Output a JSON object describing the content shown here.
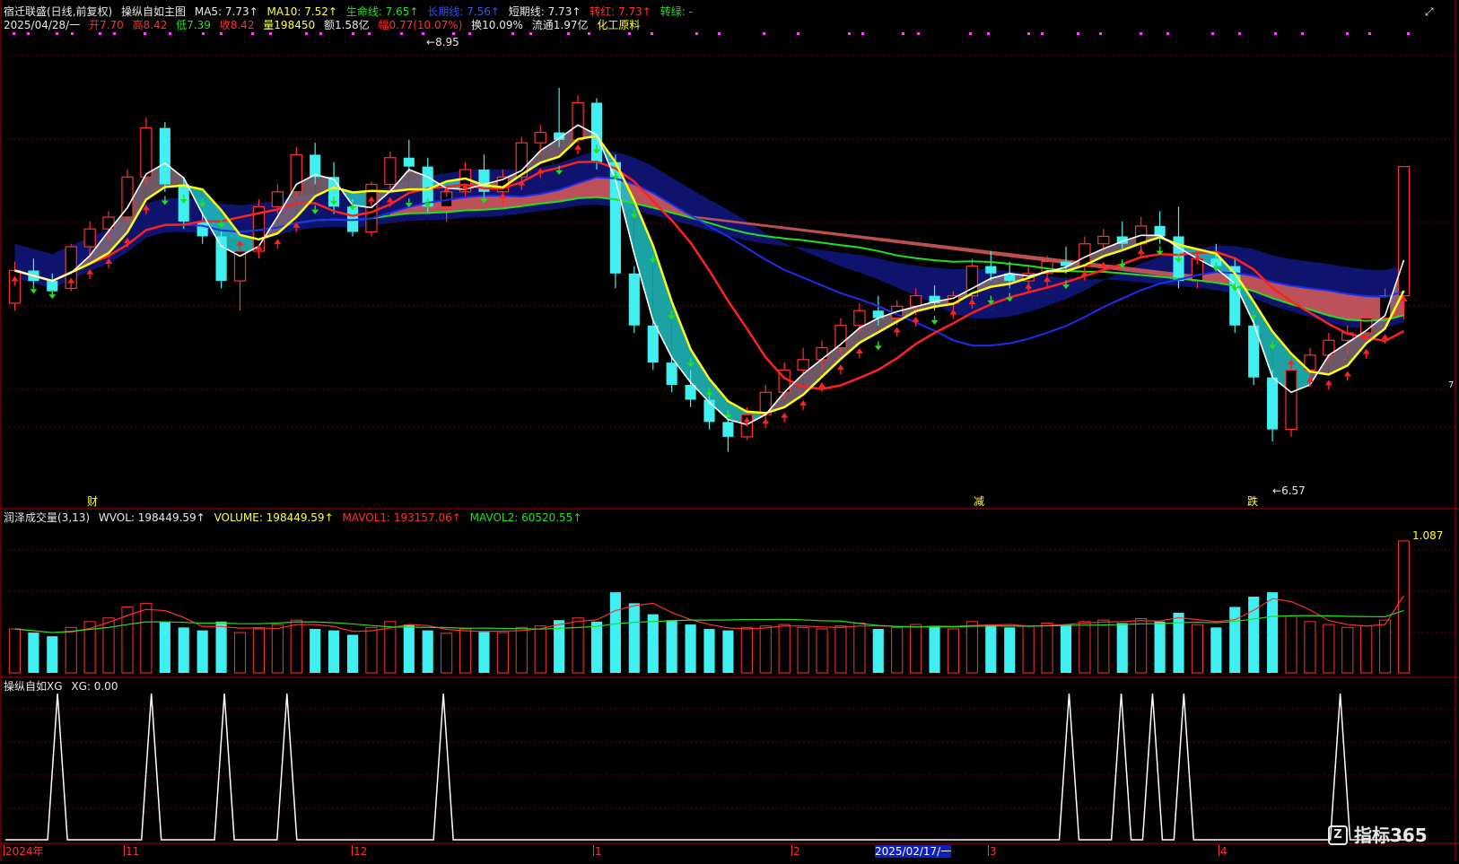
{
  "header": {
    "stock_name": "宿迁联盛(日线,前复权)",
    "indicator_name": "操纵自如主图",
    "ma5": "MA5: 7.73↑",
    "ma10": "MA10: 7.52↑",
    "life_line": "生命线: 7.65↑",
    "long_line": "长期线: 7.56↑",
    "short_line": "短期线: 7.73↑",
    "turn_red": "转红: 7.73↑",
    "turn_green": "转绿: -"
  },
  "info_bar": {
    "date": "2025/04/28/一",
    "open": "开7.70",
    "high": "高8.42",
    "low": "低7.39",
    "close": "收8.42",
    "volume": "量198450",
    "amount": "额1.58亿",
    "change": "幅0.77(10.07%)",
    "turnover": "换10.09%",
    "float": "流通1.97亿",
    "sector": "化工原料"
  },
  "annotations": {
    "high_marker": "8.95",
    "low_marker": "6.57",
    "event_cai": "财",
    "event_jian": "减",
    "event_die": "跌",
    "right_price": "7"
  },
  "volume_panel": {
    "title": "润泽成交量(3,13)",
    "wvol": "WVOL: 198449.59↑",
    "volume": "VOLUME: 198449.59↑",
    "mavol1": "MAVOL1: 193157.06↑",
    "mavol2": "MAVOL2: 60520.55↑",
    "scale_label": "1.087"
  },
  "xg_panel": {
    "title": "操纵自如XG",
    "xg": "XG: 0.00"
  },
  "x_axis": {
    "labels": [
      "2024年",
      "11",
      "12",
      "1",
      "2",
      "2025/02/17/一",
      "3",
      "4"
    ]
  },
  "watermark": "指标365",
  "colors": {
    "up": "#ff3030",
    "down": "#40f0f0",
    "ma_white": "#ffffff",
    "ma_yellow": "#ffff00",
    "life_green": "#20e020",
    "long_blue": "#1c2cf0",
    "band_blue": "#101880",
    "band_red": "#d05858"
  },
  "chart_data": {
    "type": "candlestick",
    "ylim": [
      6.4,
      9.3
    ],
    "candles": [
      [
        7.5,
        7.78,
        7.45,
        7.72
      ],
      [
        7.72,
        7.8,
        7.6,
        7.65
      ],
      [
        7.65,
        7.7,
        7.55,
        7.58
      ],
      [
        7.6,
        7.9,
        7.58,
        7.88
      ],
      [
        7.88,
        8.05,
        7.8,
        8.0
      ],
      [
        8.0,
        8.12,
        7.92,
        8.08
      ],
      [
        8.08,
        8.4,
        8.05,
        8.35
      ],
      [
        8.35,
        8.75,
        8.3,
        8.68
      ],
      [
        8.68,
        8.72,
        8.25,
        8.3
      ],
      [
        8.3,
        8.35,
        8.0,
        8.05
      ],
      [
        8.05,
        8.1,
        7.9,
        7.95
      ],
      [
        7.95,
        8.0,
        7.6,
        7.65
      ],
      [
        7.65,
        7.9,
        7.45,
        7.85
      ],
      [
        7.85,
        8.2,
        7.8,
        8.15
      ],
      [
        8.15,
        8.3,
        8.1,
        8.25
      ],
      [
        8.25,
        8.55,
        8.2,
        8.5
      ],
      [
        8.5,
        8.58,
        8.3,
        8.35
      ],
      [
        8.35,
        8.45,
        8.1,
        8.15
      ],
      [
        8.15,
        8.2,
        7.95,
        7.98
      ],
      [
        7.98,
        8.32,
        7.95,
        8.3
      ],
      [
        8.3,
        8.52,
        8.25,
        8.48
      ],
      [
        8.48,
        8.6,
        8.38,
        8.42
      ],
      [
        8.42,
        8.48,
        8.1,
        8.15
      ],
      [
        8.15,
        8.3,
        8.05,
        8.25
      ],
      [
        8.25,
        8.45,
        8.2,
        8.4
      ],
      [
        8.4,
        8.5,
        8.2,
        8.25
      ],
      [
        8.25,
        8.4,
        8.15,
        8.35
      ],
      [
        8.35,
        8.62,
        8.3,
        8.58
      ],
      [
        8.58,
        8.7,
        8.5,
        8.65
      ],
      [
        8.65,
        8.95,
        8.55,
        8.6
      ],
      [
        8.6,
        8.9,
        8.58,
        8.85
      ],
      [
        8.85,
        8.88,
        8.4,
        8.45
      ],
      [
        8.45,
        8.5,
        7.6,
        7.7
      ],
      [
        7.7,
        7.75,
        7.3,
        7.35
      ],
      [
        7.35,
        7.4,
        7.05,
        7.1
      ],
      [
        7.1,
        7.15,
        6.9,
        6.95
      ],
      [
        6.95,
        7.05,
        6.8,
        6.85
      ],
      [
        6.85,
        6.9,
        6.65,
        6.7
      ],
      [
        6.7,
        6.78,
        6.5,
        6.6
      ],
      [
        6.6,
        6.8,
        6.58,
        6.75
      ],
      [
        6.75,
        6.95,
        6.7,
        6.9
      ],
      [
        6.9,
        7.1,
        6.85,
        7.05
      ],
      [
        7.05,
        7.2,
        7.0,
        7.12
      ],
      [
        7.12,
        7.25,
        7.05,
        7.2
      ],
      [
        7.2,
        7.4,
        7.15,
        7.35
      ],
      [
        7.35,
        7.5,
        7.3,
        7.45
      ],
      [
        7.45,
        7.55,
        7.35,
        7.4
      ],
      [
        7.4,
        7.52,
        7.35,
        7.48
      ],
      [
        7.48,
        7.6,
        7.42,
        7.55
      ],
      [
        7.55,
        7.62,
        7.45,
        7.5
      ],
      [
        7.5,
        7.58,
        7.42,
        7.55
      ],
      [
        7.55,
        7.8,
        7.5,
        7.75
      ],
      [
        7.75,
        7.85,
        7.65,
        7.7
      ],
      [
        7.7,
        7.78,
        7.6,
        7.65
      ],
      [
        7.65,
        7.75,
        7.58,
        7.7
      ],
      [
        7.7,
        7.82,
        7.62,
        7.78
      ],
      [
        7.78,
        7.88,
        7.7,
        7.75
      ],
      [
        7.75,
        7.95,
        7.7,
        7.9
      ],
      [
        7.9,
        8.0,
        7.85,
        7.95
      ],
      [
        7.95,
        8.05,
        7.85,
        7.9
      ],
      [
        7.9,
        8.08,
        7.82,
        8.02
      ],
      [
        8.02,
        8.12,
        7.9,
        7.95
      ],
      [
        7.95,
        8.15,
        7.6,
        7.65
      ],
      [
        7.65,
        7.85,
        7.6,
        7.8
      ],
      [
        7.8,
        7.9,
        7.7,
        7.75
      ],
      [
        7.75,
        7.8,
        7.3,
        7.35
      ],
      [
        7.35,
        7.4,
        6.95,
        7.0
      ],
      [
        7.0,
        7.05,
        6.57,
        6.65
      ],
      [
        6.65,
        7.1,
        6.6,
        7.05
      ],
      [
        7.05,
        7.2,
        7.0,
        7.15
      ],
      [
        7.15,
        7.3,
        7.1,
        7.25
      ],
      [
        7.25,
        7.35,
        7.15,
        7.3
      ],
      [
        7.3,
        7.45,
        7.25,
        7.4
      ],
      [
        7.4,
        7.6,
        7.35,
        7.55
      ],
      [
        7.55,
        8.42,
        7.39,
        8.42
      ]
    ],
    "volume": [
      60,
      55,
      50,
      62,
      70,
      75,
      90,
      95,
      70,
      62,
      58,
      70,
      55,
      60,
      66,
      72,
      60,
      58,
      52,
      62,
      70,
      66,
      58,
      54,
      60,
      56,
      55,
      62,
      64,
      72,
      75,
      70,
      110,
      95,
      80,
      72,
      66,
      60,
      58,
      62,
      64,
      66,
      62,
      60,
      64,
      68,
      60,
      62,
      66,
      64,
      60,
      70,
      66,
      62,
      64,
      68,
      66,
      70,
      72,
      68,
      74,
      70,
      82,
      66,
      62,
      90,
      104,
      110,
      78,
      70,
      66,
      62,
      64,
      72,
      180
    ],
    "xg_peaks": [
      5,
      14,
      21,
      27,
      42,
      102,
      107,
      110,
      113,
      128
    ]
  }
}
